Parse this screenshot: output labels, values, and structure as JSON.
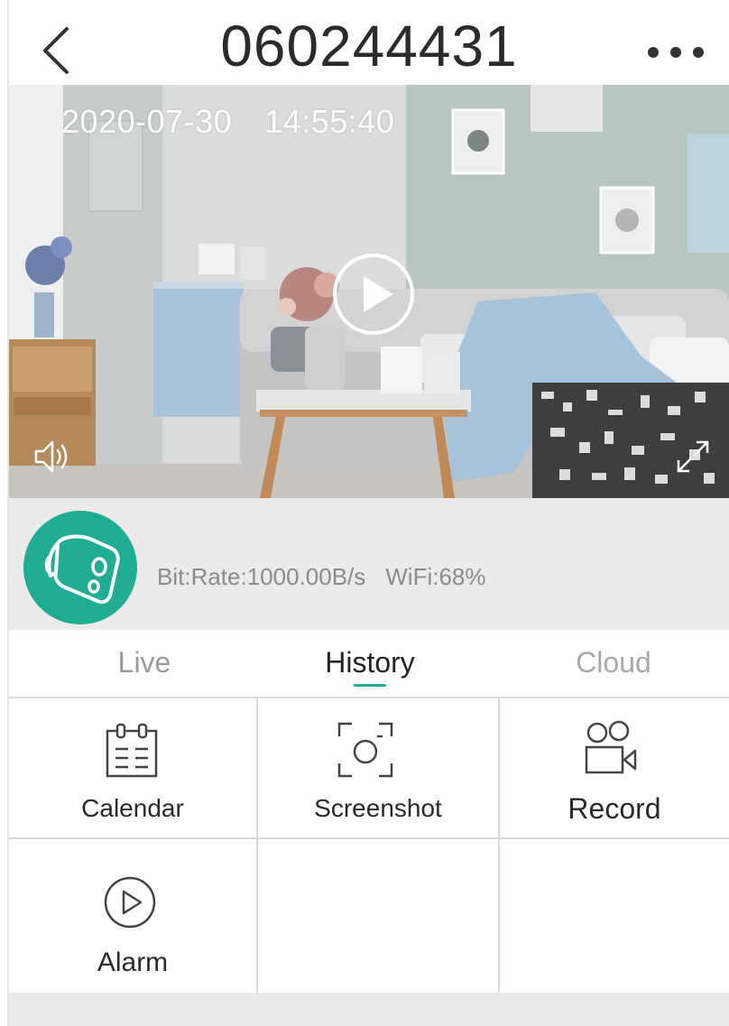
{
  "header": {
    "title": "060244431",
    "back_icon": "chevron-left-icon",
    "more_icon": "more-horizontal-icon"
  },
  "video": {
    "date": "2020-07-30",
    "time": "14:55:40",
    "play_icon": "play-circle-icon",
    "sound_icon": "speaker-icon",
    "fullscreen_icon": "expand-icon"
  },
  "status": {
    "device_icon": "camera-icon",
    "bitrate": "Bit:Rate:1000.00B/s",
    "wifi": "WiFi:68%"
  },
  "tabs": {
    "live": "Live",
    "history": "History",
    "cloud": "Cloud",
    "active": "History"
  },
  "actions": {
    "calendar": "Calendar",
    "screenshot": "Screenshot",
    "record": "Record",
    "alarm": "Alarm"
  },
  "colors": {
    "accent": "#21ad93",
    "muted_text": "#8c8c8c",
    "panel_bg": "#ebebeb"
  }
}
